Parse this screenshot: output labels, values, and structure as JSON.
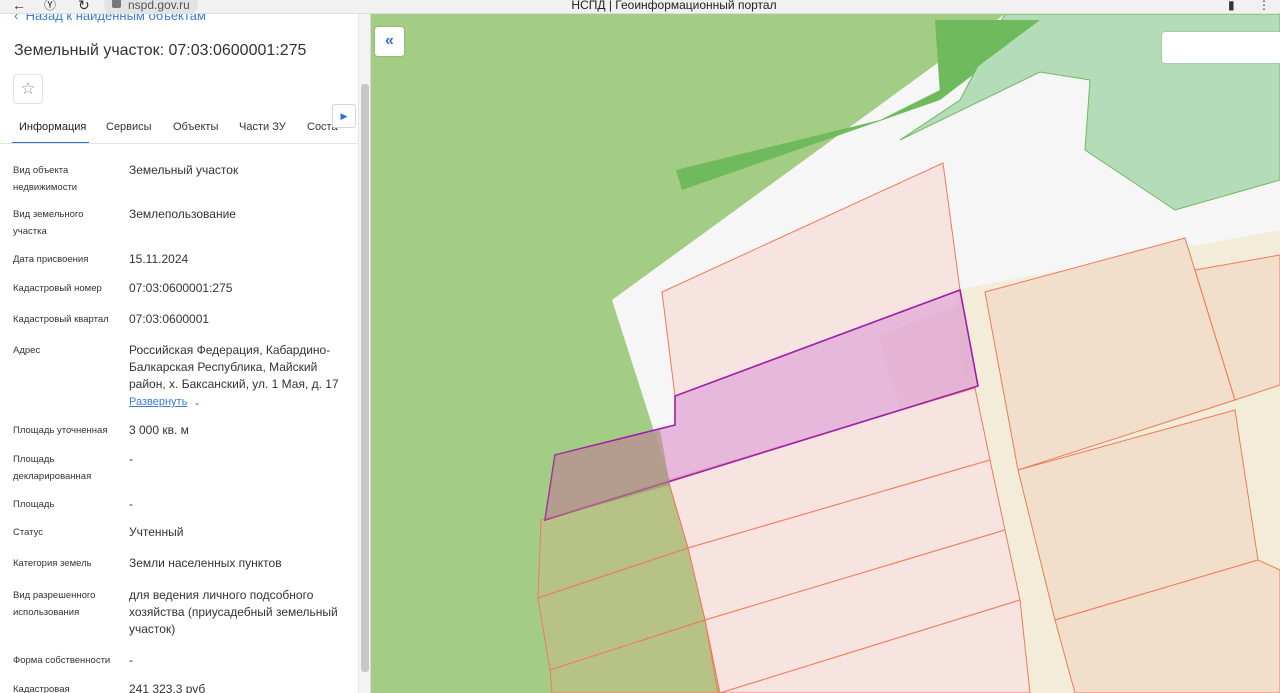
{
  "browser": {
    "url": "nspd.gov.ru",
    "title": "НСПД | Геоинформационный портал",
    "back_icon": "arrow-left-icon",
    "reload_icon": "reload-icon",
    "bookmark_icon": "bookmark-icon"
  },
  "panel": {
    "back_link": "Назад к найденным объектам",
    "title": "Земельный участок: 07:03:0600001:275",
    "tabs": [
      "Информация",
      "Сервисы",
      "Объекты",
      "Части ЗУ",
      "Соста"
    ],
    "active_tab": 0,
    "properties": [
      {
        "label": "Вид объекта недвижимости",
        "value": "Земельный участок"
      },
      {
        "label": "Вид земельного участка",
        "value": "Землепользование"
      },
      {
        "label": "Дата присвоения",
        "value": "15.11.2024"
      },
      {
        "label": "Кадастровый номер",
        "value": "07:03:0600001:275"
      },
      {
        "label": "Кадастровый квартал",
        "value": "07:03:0600001"
      },
      {
        "label": "Адрес",
        "value": "Российская Федерация, Кабардино-Балкарская Республика, Майский район, х. Баксанский, ул. 1 Мая, д. 17"
      },
      {
        "label": "Площадь уточненная",
        "value": "3 000 кв. м"
      },
      {
        "label": "Площадь декларированная",
        "value": "-"
      },
      {
        "label": "Площадь",
        "value": "-"
      },
      {
        "label": "Статус",
        "value": "Учтенный"
      },
      {
        "label": "Категория земель",
        "value": "Земли населенных пунктов"
      },
      {
        "label": "Вид разрешенного использования",
        "value": "для ведения личного подсобного хозяйства (приусадебный земельный участок)"
      },
      {
        "label": "Форма собственности",
        "value": "-"
      },
      {
        "label": "Кадастровая",
        "value": "241 323,3 руб"
      }
    ],
    "expand_label": "Развернуть"
  },
  "map": {
    "collapse_icon": "double-chevron-left-icon",
    "colors": {
      "forest": "#a3cd85",
      "forest_dark": "#6fba5c",
      "forest_light": "#b5dcb8",
      "road": "#f6f6f6",
      "parcel_fill": "#f7e3df",
      "parcel_stroke": "#f07a5a",
      "zone_fill": "#f2ecd9",
      "selected_fill": "#e6b6da",
      "selected_stroke": "#a01ea8"
    }
  }
}
